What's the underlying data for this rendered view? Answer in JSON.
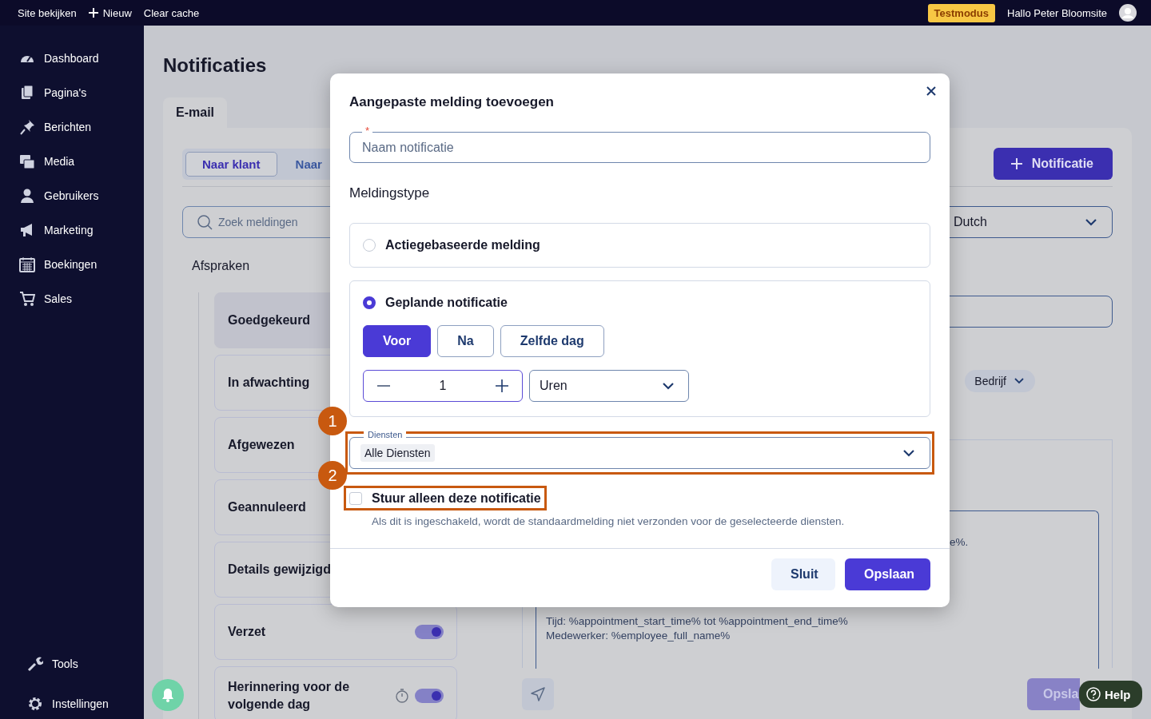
{
  "topbar": {
    "links": [
      {
        "label": "Site bekijken",
        "kind": "link"
      },
      {
        "label": "Nieuw",
        "kind": "add"
      },
      {
        "label": "Clear cache",
        "kind": "link"
      }
    ],
    "badge": "Testmodus",
    "greeting": "Hallo Peter Bloomsite"
  },
  "sidebar": {
    "items": [
      {
        "label": "Dashboard"
      },
      {
        "label": "Pagina's"
      },
      {
        "label": "Berichten"
      },
      {
        "label": "Media"
      },
      {
        "label": "Gebruikers"
      },
      {
        "label": "Marketing"
      },
      {
        "label": "Boekingen"
      },
      {
        "label": "Sales"
      }
    ],
    "bottom_items": [
      {
        "label": "Tools"
      },
      {
        "label": "Instellingen"
      }
    ]
  },
  "page": {
    "title": "Notificaties",
    "channel_tabs": [
      {
        "label": "E-mail",
        "selected": true
      }
    ],
    "audience_tabs": [
      {
        "label": "Naar klant",
        "selected": true
      },
      {
        "label": "Naar",
        "selected": false
      }
    ],
    "add_button": "Notificatie",
    "search": {
      "placeholder": "Zoek meldingen"
    },
    "language": "Dutch",
    "group": "Afspraken",
    "notifications": [
      {
        "label": "Goedgekeurd",
        "selected": true,
        "kind": "plain"
      },
      {
        "label": "In afwachting",
        "selected": false,
        "kind": "plain"
      },
      {
        "label": "Afgewezen",
        "selected": false,
        "kind": "plain"
      },
      {
        "label": "Geannuleerd",
        "selected": false,
        "kind": "plain"
      },
      {
        "label": "Details gewijzigd",
        "selected": false,
        "kind": "plain"
      },
      {
        "label": "Verzet",
        "selected": false,
        "kind": "toggle",
        "on": true
      },
      {
        "label": "Herinnering voor de volgende dag",
        "selected": false,
        "kind": "timed",
        "on": true
      }
    ],
    "chip": "Bedrijf",
    "editor_lines": [
      "e%.",
      "Tijd: %appointment_start_time% tot %appointment_end_time%",
      "Medewerker: %employee_full_name%"
    ],
    "save_button": "Opsla",
    "help": "Help"
  },
  "modal": {
    "title": "Aangepaste melding toevoegen",
    "name_field": {
      "placeholder": "Naam notificatie",
      "required": true,
      "required_marker": "*"
    },
    "section": "Meldingstype",
    "types": [
      {
        "label": "Actiegebaseerde melding",
        "selected": false
      },
      {
        "label": "Geplande notificatie",
        "selected": true
      }
    ],
    "timing": [
      {
        "label": "Voor",
        "selected": true
      },
      {
        "label": "Na",
        "selected": false
      },
      {
        "label": "Zelfde dag",
        "selected": false
      }
    ],
    "count": "1",
    "unit": "Uren",
    "services": {
      "label": "Diensten",
      "value": "Alle Diensten"
    },
    "only_this": {
      "label": "Stuur alleen deze notificatie",
      "checked": false,
      "hint": "Als dit is ingeschakeld, wordt de standaardmelding niet verzonden voor de geselecteerde diensten."
    },
    "buttons": [
      {
        "label": "Sluit",
        "kind": "secondary"
      },
      {
        "label": "Opslaan",
        "kind": "primary"
      }
    ]
  },
  "annotations": [
    {
      "number": "1"
    },
    {
      "number": "2"
    }
  ]
}
